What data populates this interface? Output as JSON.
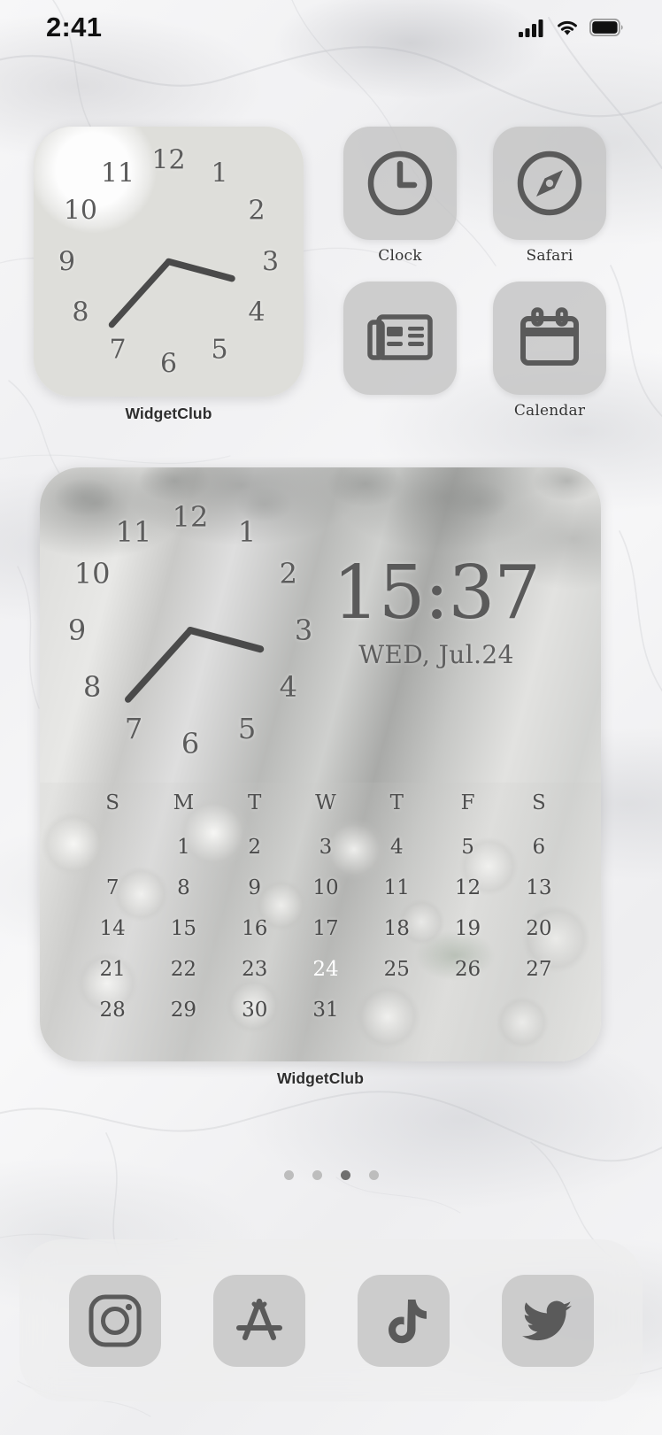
{
  "status_bar": {
    "time": "2:41",
    "cellular_icon": "signal-bars-icon",
    "wifi_icon": "wifi-icon",
    "battery_icon": "battery-full-icon"
  },
  "home_screen": {
    "small_widget": {
      "label": "WidgetClub",
      "type": "analog-clock",
      "hour_numbers": [
        "12",
        "1",
        "2",
        "3",
        "4",
        "5",
        "6",
        "7",
        "8",
        "9",
        "10",
        "11"
      ],
      "hour_hand_angle": 105,
      "minute_hand_angle": 222
    },
    "apps": [
      {
        "name": "Clock",
        "label": "Clock",
        "icon": "clock-icon"
      },
      {
        "name": "Safari",
        "label": "Safari",
        "icon": "safari-compass-icon"
      },
      {
        "name": "News",
        "label": "",
        "icon": "news-paper-icon"
      },
      {
        "name": "Calendar",
        "label": "Calendar",
        "icon": "calendar-icon"
      }
    ],
    "large_widget": {
      "label": "WidgetClub",
      "digital_time": "15:37",
      "digital_date": "WED, Jul.24",
      "hour_numbers": [
        "12",
        "1",
        "2",
        "3",
        "4",
        "5",
        "6",
        "7",
        "8",
        "9",
        "10",
        "11"
      ],
      "hour_hand_angle": 105,
      "minute_hand_angle": 222,
      "calendar": {
        "weekday_headers": [
          "S",
          "M",
          "T",
          "W",
          "T",
          "F",
          "S"
        ],
        "weeks": [
          [
            "",
            "1",
            "2",
            "3",
            "4",
            "5",
            "6"
          ],
          [
            "7",
            "8",
            "9",
            "10",
            "11",
            "12",
            "13"
          ],
          [
            "14",
            "15",
            "16",
            "17",
            "18",
            "19",
            "20"
          ],
          [
            "21",
            "22",
            "23",
            "24",
            "25",
            "26",
            "27"
          ],
          [
            "28",
            "29",
            "30",
            "31",
            "",
            "",
            ""
          ]
        ],
        "today": "24",
        "today_highlight_color": "#4a4a48",
        "today_text_color": "#ffffff"
      }
    },
    "page_dots": {
      "count": 4,
      "active_index": 2
    },
    "dock": [
      {
        "name": "Instagram",
        "icon": "instagram-icon"
      },
      {
        "name": "App Store",
        "icon": "app-store-icon"
      },
      {
        "name": "TikTok",
        "icon": "tiktok-icon"
      },
      {
        "name": "Twitter",
        "icon": "twitter-bird-icon"
      }
    ]
  },
  "theme": {
    "icon_tile_color": "#c4c4c4",
    "icon_glyph_color": "#5a5a5a",
    "dock_background": "#eeeeee",
    "label_color": "#343434"
  }
}
